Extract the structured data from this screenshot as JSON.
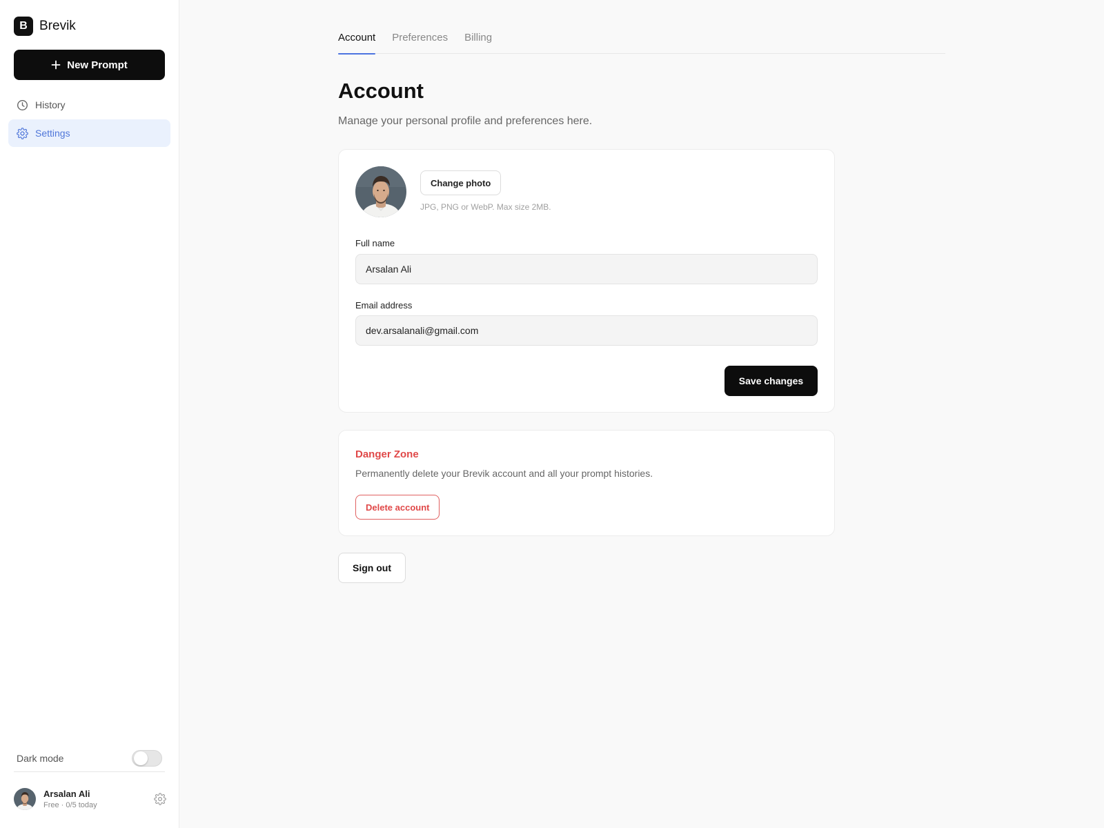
{
  "app": {
    "brand_initial": "B",
    "brand_name": "Brevik"
  },
  "sidebar": {
    "new_prompt_label": "New Prompt",
    "items": [
      {
        "label": "History",
        "icon": "clock-icon",
        "active": false
      },
      {
        "label": "Settings",
        "icon": "gear-icon",
        "active": true
      }
    ],
    "dark_mode_label": "Dark mode",
    "dark_mode_on": false,
    "user": {
      "name": "Arsalan Ali",
      "plan": "Free · 0/5 today"
    }
  },
  "tabs": [
    {
      "label": "Account",
      "active": true
    },
    {
      "label": "Preferences",
      "active": false
    },
    {
      "label": "Billing",
      "active": false
    }
  ],
  "page": {
    "title": "Account",
    "subtitle": "Manage your personal profile and preferences here."
  },
  "profile": {
    "change_photo_label": "Change photo",
    "photo_hint": "JPG, PNG or WebP. Max size 2MB.",
    "full_name_label": "Full name",
    "full_name_value": "Arsalan Ali",
    "email_label": "Email address",
    "email_value": "dev.arsalanali@gmail.com",
    "save_label": "Save changes"
  },
  "danger": {
    "title": "Danger Zone",
    "description": "Permanently delete your Brevik account and all your prompt histories.",
    "delete_label": "Delete account"
  },
  "sign_out_label": "Sign out",
  "colors": {
    "accent": "#4c74e0",
    "active_nav_bg": "#eaf1fd",
    "danger": "#e04848",
    "primary_button": "#0d0d0d"
  }
}
